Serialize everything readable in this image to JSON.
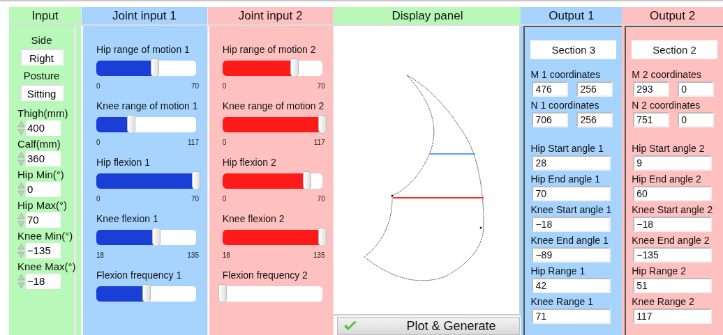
{
  "input": {
    "title": "Input",
    "side": {
      "label": "Side",
      "value": "Right"
    },
    "posture": {
      "label": "Posture",
      "value": "Sitting"
    },
    "spinners": [
      {
        "label": "Thigh(mm)",
        "value": "400"
      },
      {
        "label": "Calf(mm)",
        "value": "360"
      },
      {
        "label": "Hip Min(°)",
        "value": "0"
      },
      {
        "label": "Hip Max(°)",
        "value": "70"
      },
      {
        "label": "Knee Min(°)",
        "value": "−135"
      },
      {
        "label": "Knee Max(°)",
        "value": "−18"
      }
    ]
  },
  "joint_inputs": [
    {
      "title": "Joint input 1",
      "color": "#1a3fd6",
      "sliders": [
        {
          "label": "Hip range of motion 1",
          "level": 0.59,
          "min": "0",
          "max": "70"
        },
        {
          "label": "Knee range of motion 1",
          "level": 0.35,
          "min": "0",
          "max": "117"
        },
        {
          "label": "Hip flexion 1",
          "level": 1,
          "min": "0",
          "max": "70"
        },
        {
          "label": "Knee flexion 1",
          "level": 0.6,
          "min": "18",
          "max": "135"
        },
        {
          "label": "Flexion frequency 1",
          "level": 0.5
        }
      ]
    },
    {
      "title": "Joint input 2",
      "color": "#ff1a1a",
      "sliders": [
        {
          "label": "Hip range of motion 2",
          "level": 0.72,
          "min": "0",
          "max": "70"
        },
        {
          "label": "Knee range of motion 2",
          "level": 1,
          "min": "0",
          "max": "117"
        },
        {
          "label": "Hip flexion 2",
          "level": 0.85,
          "min": "0",
          "max": "70"
        },
        {
          "label": "Knee flexion 2",
          "level": 1,
          "min": "18",
          "max": "135"
        },
        {
          "label": "Flexion frequency 2",
          "level": 0
        }
      ]
    }
  ],
  "display": {
    "title": "Display panel",
    "button": "Plot & Generate"
  },
  "outputs": [
    {
      "title": "Output 1",
      "color": "#a6d4ff",
      "section": "Section 3",
      "coordinates": [
        {
          "label": "M 1 coordinates",
          "values": [
            "476",
            "256"
          ]
        },
        {
          "label": "N 1 coordinates",
          "values": [
            "706",
            "256"
          ]
        }
      ],
      "fields": [
        {
          "label": "Hip Start angle 1",
          "value": "28"
        },
        {
          "label": "Hip End angle 1",
          "value": "70"
        },
        {
          "label": "Knee Start angle 1",
          "value": "−18"
        },
        {
          "label": "Knee End angle 1",
          "value": "−89"
        },
        {
          "label": "Hip Range 1",
          "value": "42"
        },
        {
          "label": "Knee Range 1",
          "value": "71"
        }
      ]
    },
    {
      "title": "Output 2",
      "color": "#ffc0c0",
      "section": "Section 2",
      "coordinates": [
        {
          "label": "M 2 coordinates",
          "values": [
            "293",
            "0"
          ]
        },
        {
          "label": "N 2 coordinates",
          "values": [
            "751",
            "0"
          ]
        }
      ],
      "fields": [
        {
          "label": "Hip Start angle 2",
          "value": "9"
        },
        {
          "label": "Hip End angle 2",
          "value": "60"
        },
        {
          "label": "Knee Start angle 2",
          "value": "−18"
        },
        {
          "label": "Knee End angle 2",
          "value": "−135"
        },
        {
          "label": "Hip Range 2",
          "value": "51"
        },
        {
          "label": "Knee Range 2",
          "value": "117"
        }
      ]
    }
  ]
}
